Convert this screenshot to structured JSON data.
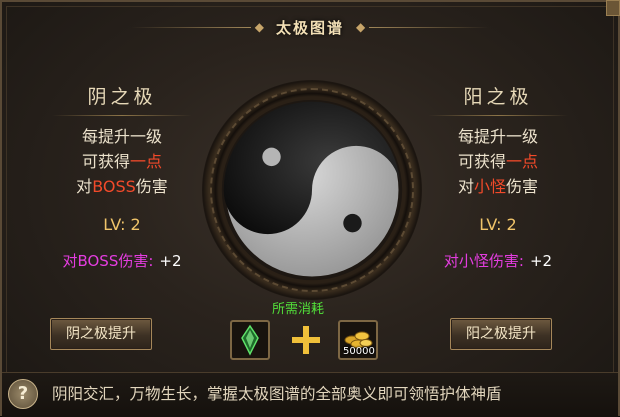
{
  "title": "太极图谱",
  "left_panel": {
    "title": "阴之极",
    "desc_line1": "每提升一级",
    "desc_line2_pre": "可获得",
    "desc_line2_hl": "一点",
    "desc_line3_pre": "对",
    "desc_line3_hl": "BOSS",
    "desc_line3_post": "伤害",
    "level": "LV: 2",
    "bonus_label": "对BOSS伤害:",
    "bonus_value": "+2",
    "button": "阴之极提升"
  },
  "right_panel": {
    "title": "阳之极",
    "desc_line1": "每提升一级",
    "desc_line2_pre": "可获得",
    "desc_line2_hl": "一点",
    "desc_line3_pre": "对",
    "desc_line3_hl": "小怪",
    "desc_line3_post": "伤害",
    "level": "LV: 2",
    "bonus_label": "对小怪伤害:",
    "bonus_value": "+2",
    "button": "阳之极提升"
  },
  "requirement": {
    "label": "所需消耗",
    "item_icon": "green-crystal-icon",
    "coin_icon": "gold-coins-icon",
    "coin_amount": "50000"
  },
  "footer": {
    "help_icon": "?",
    "text": "阴阳交汇，万物生长，掌握太极图谱的全部奥义即可领悟护体神盾"
  },
  "colors": {
    "highlight": "#f24a2a",
    "bonus_label": "#e43de0",
    "level": "#f0c46a",
    "requirement": "#52e03a"
  }
}
